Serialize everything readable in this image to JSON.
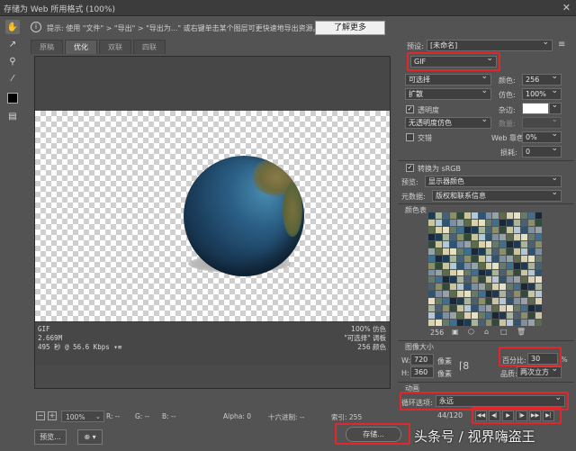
{
  "window": {
    "title": "存储为 Web 所用格式 (100%)",
    "close": "✕"
  },
  "hint": {
    "text": "提示: 使用 \"文件\" > \"导出\" > \"导出为...\" 或右键单击某个图层可更快速地导出资源。",
    "learn_more": "了解更多"
  },
  "tabs": [
    "原稿",
    "优化",
    "双联",
    "四联"
  ],
  "active_tab": 1,
  "image_info": {
    "format": "GIF",
    "size": "2.669M",
    "time": "495 秒 @ 56.6 Kbps",
    "dither_pct": "100% 仿色",
    "palette": "\"可选择\" 调板",
    "colors": "256 颜色"
  },
  "status": {
    "zoom": "100%",
    "r": "R: --",
    "g": "G: --",
    "b": "B: --",
    "alpha": "Alpha: 0",
    "hex": "十六进制: --",
    "index": "索引: 255"
  },
  "buttons": {
    "preview": "预览...",
    "save": "存储..."
  },
  "settings": {
    "preset_label": "预设:",
    "preset_value": "[未命名]",
    "format": "GIF",
    "reduction": "可选择",
    "colors_label": "颜色:",
    "colors_value": "256",
    "dither_algo": "扩散",
    "dither_label": "仿色:",
    "dither_value": "100%",
    "transparency_label": "透明度",
    "matte_label": "杂边:",
    "no_transparency_dither": "无透明度仿色",
    "amount_label": "数量:",
    "interlaced_label": "交错",
    "web_snap_label": "Web 靠色:",
    "web_snap_value": "0%",
    "lossy_label": "损耗:",
    "lossy_value": "0",
    "convert_srgb": "转换为 sRGB",
    "preview_label": "预览:",
    "preview_value": "显示器颜色",
    "metadata_label": "元数据:",
    "metadata_value": "版权和联系信息",
    "color_table_label": "颜色表",
    "color_count": "256"
  },
  "image_size": {
    "label": "图像大小",
    "w_label": "W:",
    "w_value": "720",
    "h_label": "H:",
    "h_value": "360",
    "unit": "像素",
    "percent_label": "百分比:",
    "percent_value": "30",
    "percent_unit": "%",
    "quality_label": "品质:",
    "quality_value": "两次立方"
  },
  "animation": {
    "label": "动画",
    "loop_label": "循环选项:",
    "loop_value": "永远",
    "frame": "44/120"
  },
  "watermark": "头条号 / 视界嗨盗王",
  "colors": {
    "highlight": "#e0282c",
    "panel": "#535353"
  }
}
